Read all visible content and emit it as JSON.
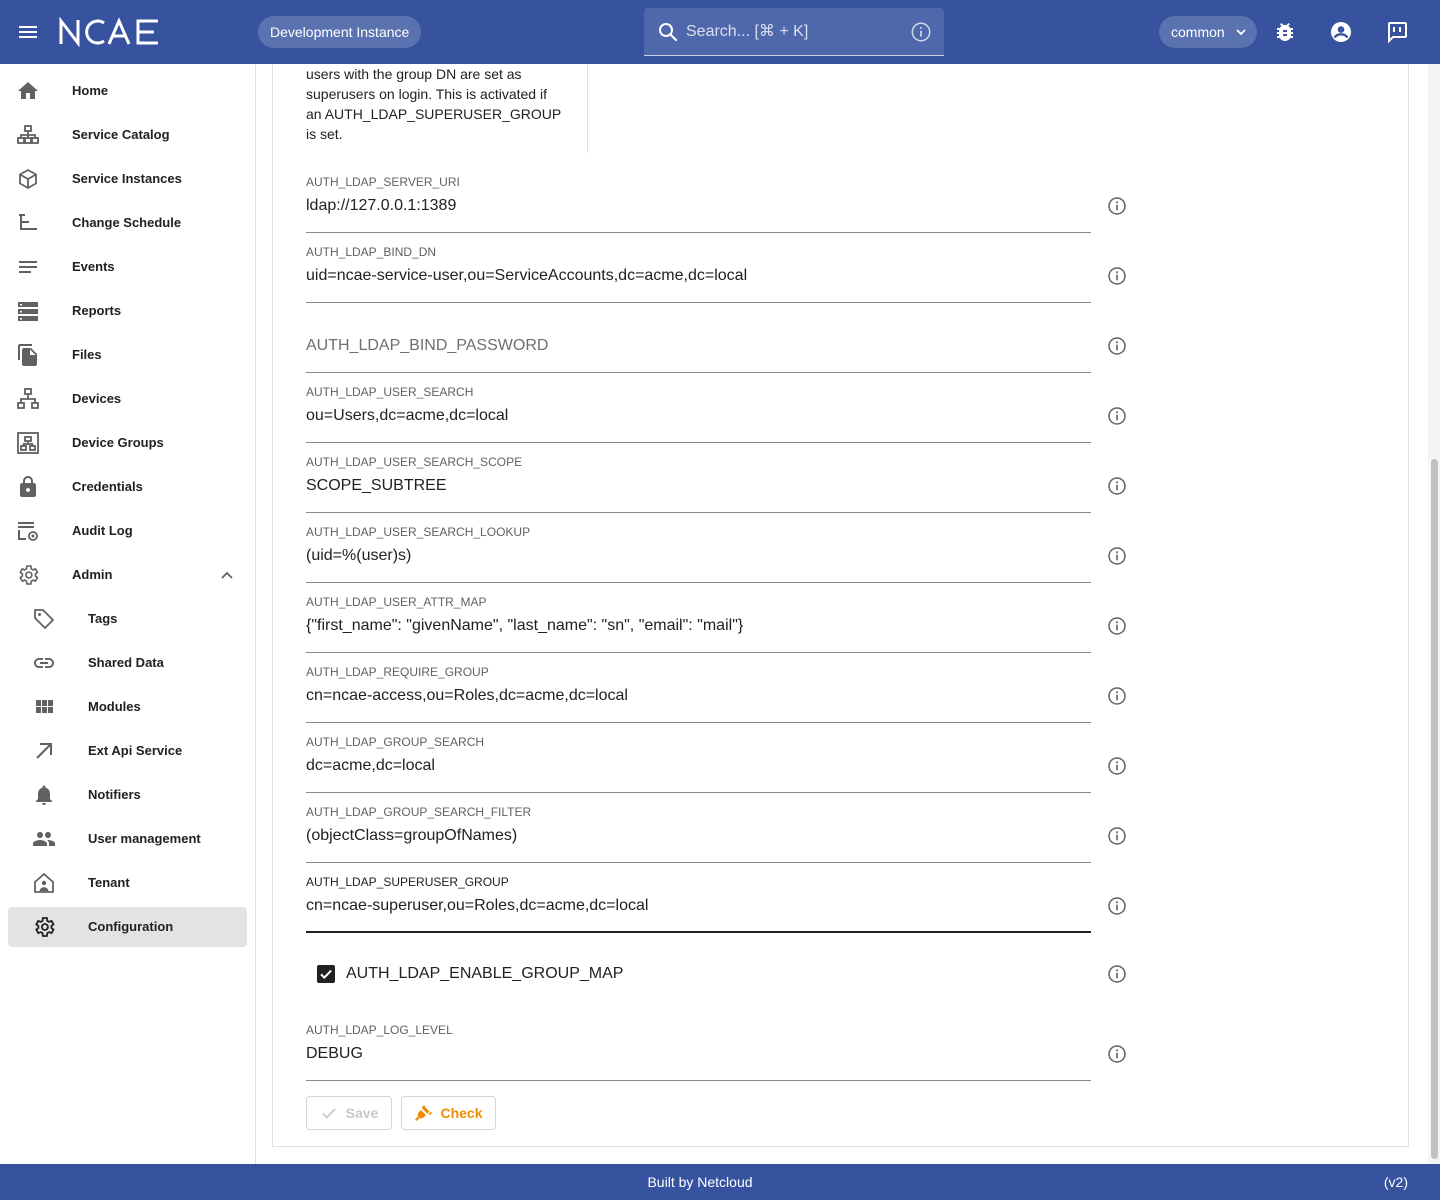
{
  "header": {
    "brand": "NCAE",
    "environment": "Development Instance",
    "search_placeholder": "Search... [⌘ + K]",
    "tenant": "common",
    "colors": {
      "primary": "#3753a0",
      "accent": "#f08c00"
    }
  },
  "sidebar": {
    "items": [
      {
        "label": "Home",
        "icon": "home-icon"
      },
      {
        "label": "Service Catalog",
        "icon": "catalog-icon"
      },
      {
        "label": "Service Instances",
        "icon": "cube-icon"
      },
      {
        "label": "Change Schedule",
        "icon": "schedule-icon"
      },
      {
        "label": "Events",
        "icon": "list-icon"
      },
      {
        "label": "Reports",
        "icon": "reports-icon"
      },
      {
        "label": "Files",
        "icon": "files-icon"
      },
      {
        "label": "Devices",
        "icon": "devices-icon"
      },
      {
        "label": "Device Groups",
        "icon": "device-groups-icon"
      },
      {
        "label": "Credentials",
        "icon": "lock-icon"
      },
      {
        "label": "Audit Log",
        "icon": "audit-log-icon"
      },
      {
        "label": "Admin",
        "icon": "gear-icon",
        "expanded": true
      }
    ],
    "admin_items": [
      {
        "label": "Tags",
        "icon": "tag-icon"
      },
      {
        "label": "Shared Data",
        "icon": "link-icon"
      },
      {
        "label": "Modules",
        "icon": "modules-icon"
      },
      {
        "label": "Ext Api Service",
        "icon": "arrow-outward-icon"
      },
      {
        "label": "Notifiers",
        "icon": "bell-icon"
      },
      {
        "label": "User management",
        "icon": "people-icon"
      },
      {
        "label": "Tenant",
        "icon": "tenant-icon"
      },
      {
        "label": "Configuration",
        "icon": "gear-icon",
        "active": true
      }
    ]
  },
  "config": {
    "previous_description": "users with the group DN are set as superusers on login. This is activated if an AUTH_LDAP_SUPERUSER_GROUP is set.",
    "fields": [
      {
        "label": "AUTH_LDAP_SERVER_URI",
        "value": "ldap://127.0.0.1:1389"
      },
      {
        "label": "AUTH_LDAP_BIND_DN",
        "value": "uid=ncae-service-user,ou=ServiceAccounts,dc=acme,dc=local"
      },
      {
        "label": "",
        "value": "",
        "placeholder": "AUTH_LDAP_BIND_PASSWORD"
      },
      {
        "label": "AUTH_LDAP_USER_SEARCH",
        "value": "ou=Users,dc=acme,dc=local"
      },
      {
        "label": "AUTH_LDAP_USER_SEARCH_SCOPE",
        "value": "SCOPE_SUBTREE"
      },
      {
        "label": "AUTH_LDAP_USER_SEARCH_LOOKUP",
        "value": "(uid=%(user)s)"
      },
      {
        "label": "AUTH_LDAP_USER_ATTR_MAP",
        "value": "{\"first_name\": \"givenName\", \"last_name\": \"sn\", \"email\": \"mail\"}"
      },
      {
        "label": "AUTH_LDAP_REQUIRE_GROUP",
        "value": "cn=ncae-access,ou=Roles,dc=acme,dc=local"
      },
      {
        "label": "AUTH_LDAP_GROUP_SEARCH",
        "value": "dc=acme,dc=local"
      },
      {
        "label": "AUTH_LDAP_GROUP_SEARCH_FILTER",
        "value": "(objectClass=groupOfNames)"
      },
      {
        "label": "AUTH_LDAP_SUPERUSER_GROUP",
        "value": "cn=ncae-superuser,ou=Roles,dc=acme,dc=local",
        "focused": true
      }
    ],
    "checkbox": {
      "label": "AUTH_LDAP_ENABLE_GROUP_MAP",
      "checked": true
    },
    "log_level": {
      "label": "AUTH_LDAP_LOG_LEVEL",
      "value": "DEBUG"
    },
    "buttons": {
      "save": "Save",
      "check": "Check"
    }
  },
  "footer": {
    "text": "Built by Netcloud",
    "version": "(v2)"
  }
}
